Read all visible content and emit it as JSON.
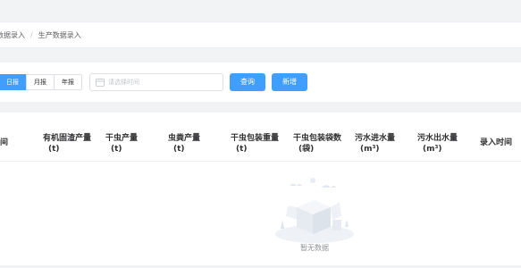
{
  "breadcrumb": {
    "items": [
      "数据录入",
      "生产数据录入"
    ],
    "separator": "/"
  },
  "filter": {
    "segments": [
      "日报",
      "月报",
      "年报"
    ],
    "active_segment": "日报",
    "date_placeholder": "请选择时间",
    "query_label": "查询",
    "add_label": "新增"
  },
  "table": {
    "columns": [
      {
        "title": "间",
        "unit": ""
      },
      {
        "title": "有机固渣产量",
        "unit": "(t)"
      },
      {
        "title": "干虫产量",
        "unit": "(t)"
      },
      {
        "title": "虫粪产量",
        "unit": "(t)"
      },
      {
        "title": "干虫包装重量",
        "unit": "(t)"
      },
      {
        "title": "干虫包装袋数",
        "unit": "(袋)"
      },
      {
        "title": "污水进水量",
        "unit": "(m³)"
      },
      {
        "title": "污水出水量",
        "unit": "(m³)"
      },
      {
        "title": "录入时间",
        "unit": ""
      }
    ],
    "empty_text": "暂无数据"
  },
  "colors": {
    "primary": "#409eff",
    "background": "#f2f3f5",
    "border": "#dcdfe6"
  }
}
